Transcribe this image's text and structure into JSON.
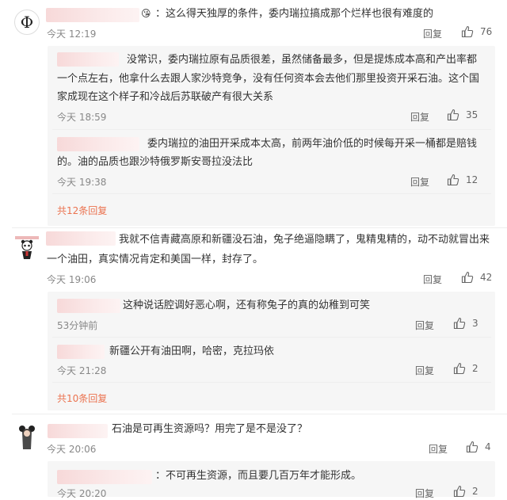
{
  "c1": {
    "text": "：这么得天独厚的条件，委内瑞拉搞成那个烂样也很有难度的",
    "time": "今天 12:19",
    "reply": "回复",
    "likes": "76",
    "replies": [
      {
        "text": "没常识，委内瑞拉原有品质很差，虽然储备最多，但是提炼成本高和产出率都",
        "text2": "一个点左右，他拿什么去跟人家沙特竞争，没有任何资本会去他们那里投资开采石油。这个国",
        "text3": "家成现在这个样子和冷战后苏联破产有很大关系",
        "time": "今天 18:59",
        "reply": "回复",
        "likes": "35"
      },
      {
        "text": "委内瑞拉的油田开采成本太高，前两年油价低的时候每开采一桶都是赔钱",
        "text2": "的。油的品质也跟沙特俄罗斯安哥拉没法比",
        "time": "今天 19:38",
        "reply": "回复",
        "likes": "12"
      }
    ],
    "more": "共12条回复"
  },
  "c2": {
    "text": "我就不信青藏高原和新疆没石油，兔子绝逼隐瞒了，鬼精鬼精的，动不动就冒出来",
    "text2": "一个油田，真实情况肯定和美国一样，封存了。",
    "time": "今天 19:06",
    "reply": "回复",
    "likes": "42",
    "replies": [
      {
        "text": "这种说话腔调好恶心啊，还有称兔子的真的幼稚到可笑",
        "time": "53分钟前",
        "reply": "回复",
        "likes": "3"
      },
      {
        "text": "新疆公开有油田啊，哈密，克拉玛依",
        "time": "今天 21:28",
        "reply": "回复",
        "likes": "2"
      }
    ],
    "more": "共10条回复"
  },
  "c3": {
    "text": "石油是可再生资源吗？用完了是不是没了？",
    "time": "今天 20:06",
    "reply": "回复",
    "likes": "4",
    "replies": [
      {
        "text": "：不可再生资源，而且要几百万年才能形成。",
        "time": "今天 20:20",
        "reply": "回复",
        "likes": "2"
      }
    ]
  },
  "colors": {
    "accent": "#eb7350",
    "sub_bg": "#f6f6f6"
  }
}
